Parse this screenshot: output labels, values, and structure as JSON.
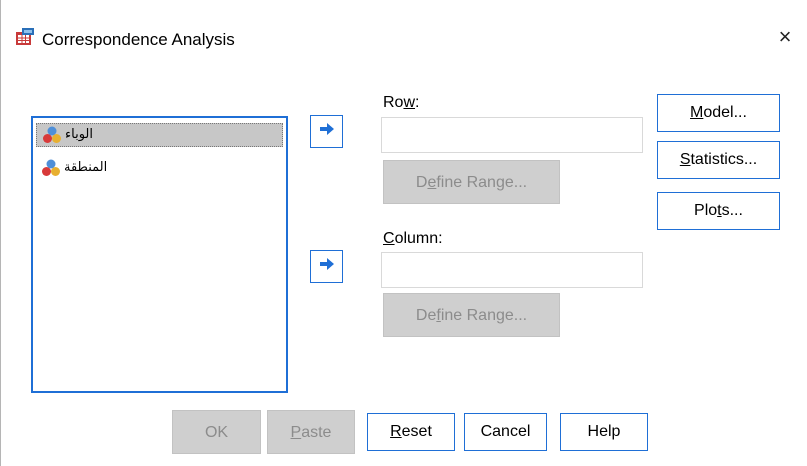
{
  "window": {
    "title": "Correspondence Analysis",
    "close_symbol": "×"
  },
  "variables": [
    {
      "label": "الوباء",
      "selected": true
    },
    {
      "label": "المنطقة",
      "selected": false
    }
  ],
  "row": {
    "label_pre": "Ro",
    "label_mn": "w",
    "label_post": ":",
    "value": "",
    "define_pre": "D",
    "define_mn": "e",
    "define_post": "fine Range..."
  },
  "column": {
    "label_mn": "C",
    "label_post": "olumn:",
    "value": "",
    "define_pre": "De",
    "define_mn": "f",
    "define_post": "ine Range..."
  },
  "side_buttons": {
    "model_mn": "M",
    "model_post": "odel...",
    "statistics_mn": "S",
    "statistics_post": "tatistics...",
    "plots_pre": "Plo",
    "plots_mn": "t",
    "plots_post": "s..."
  },
  "bottom_buttons": {
    "ok": "OK",
    "paste_mn": "P",
    "paste_post": "aste",
    "reset_mn": "R",
    "reset_post": "eset",
    "cancel": "Cancel",
    "help": "Help"
  },
  "colors": {
    "accent": "#1f6fd6",
    "disabled_bg": "#cfcfcf",
    "disabled_text": "#8c8c8c",
    "selection": "#c7c7c7"
  }
}
